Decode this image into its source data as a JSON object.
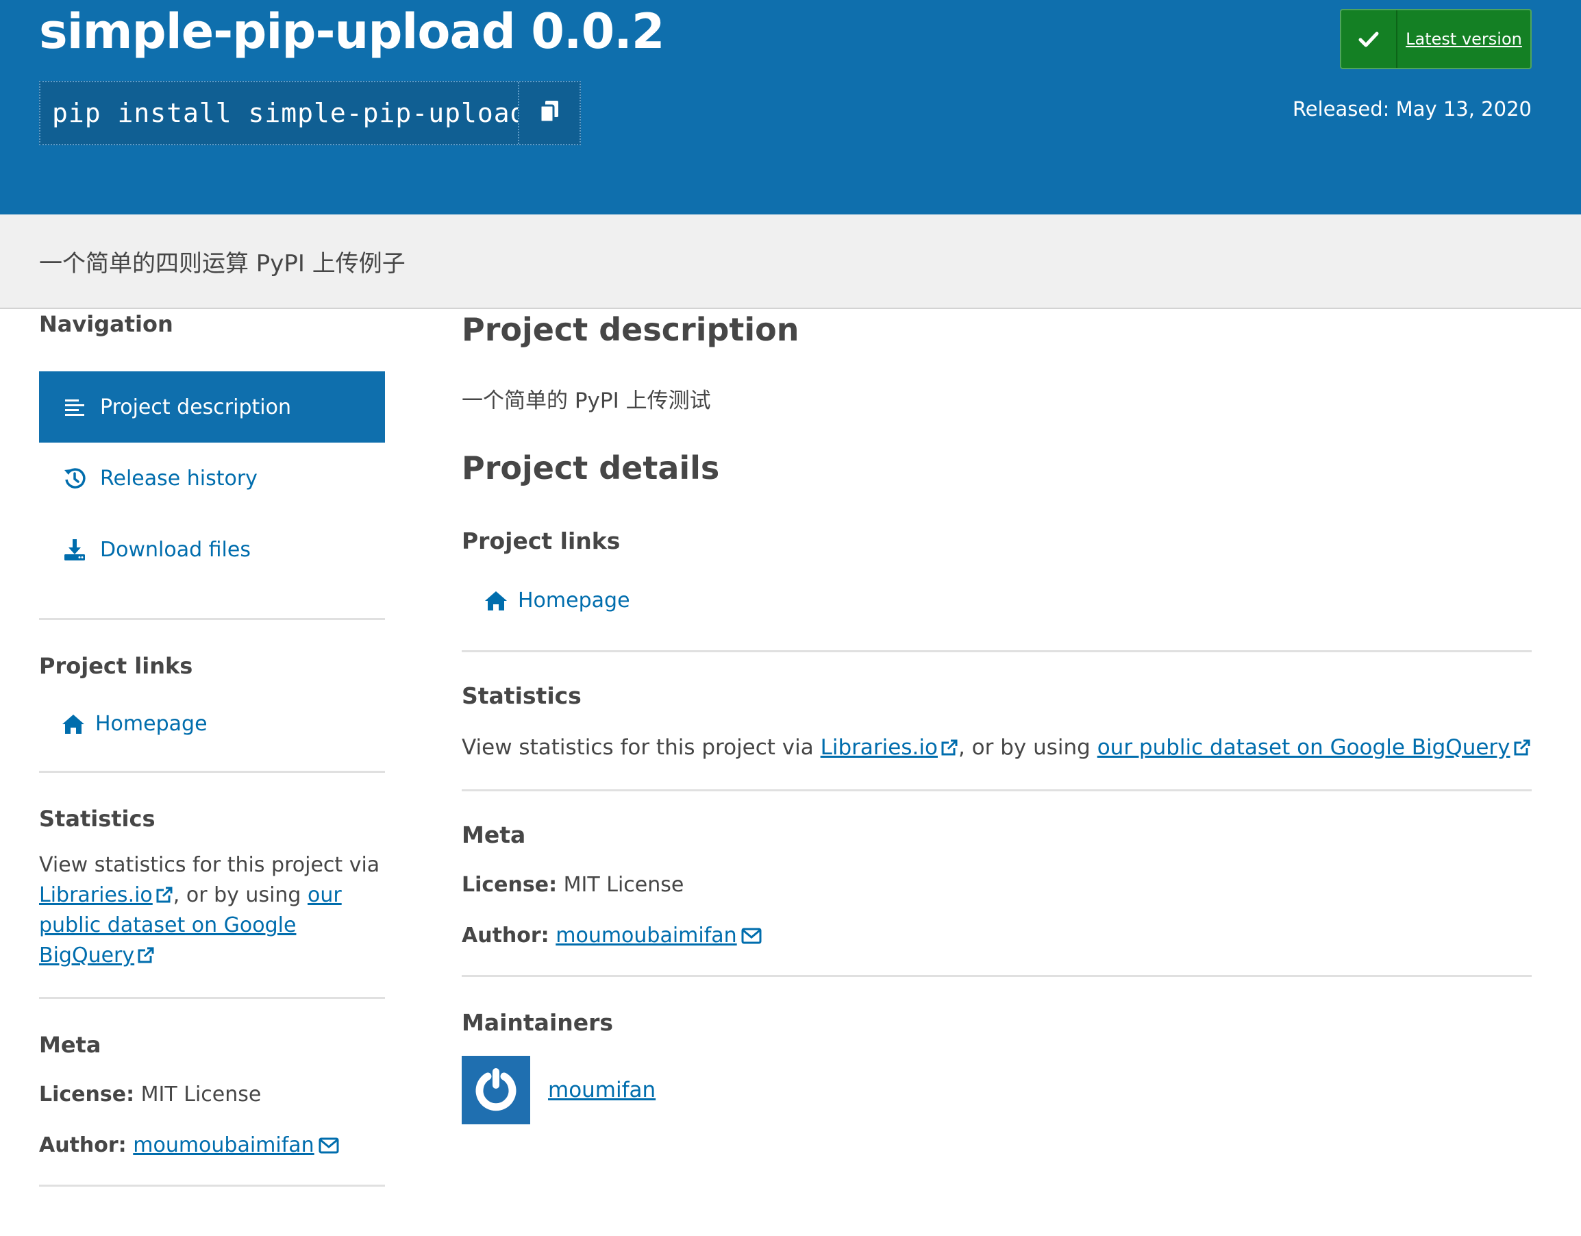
{
  "header": {
    "package_title": "simple-pip-upload 0.0.2",
    "pip_command": "pip install simple-pip-upload",
    "latest_version_label": "Latest version",
    "released_label": "Released:",
    "released_date": "May 13, 2020",
    "colors": {
      "background": "#0f6fad",
      "latest_badge": "#148024"
    }
  },
  "summary": "一个简单的四则运算 PyPI 上传例子",
  "sidebar": {
    "navigation_heading": "Navigation",
    "nav_items": [
      {
        "label": "Project description",
        "icon": "list-icon",
        "active": true
      },
      {
        "label": "Release history",
        "icon": "history-icon",
        "active": false
      },
      {
        "label": "Download files",
        "icon": "download-icon",
        "active": false
      }
    ],
    "project_links_heading": "Project links",
    "homepage_label": "Homepage",
    "statistics_heading": "Statistics",
    "stats_prefix": "View statistics for this project via",
    "stats_libraries": "Libraries.io",
    "stats_middle": ", or by using",
    "stats_bigquery": "our public dataset on Google BigQuery",
    "meta_heading": "Meta",
    "license_label": "License:",
    "license_value": "MIT License",
    "author_label": "Author:",
    "author_value": "moumoubaimifan"
  },
  "main": {
    "project_description_heading": "Project description",
    "description_text": "一个简单的 PyPI 上传测试",
    "project_details_heading": "Project details",
    "project_links_heading": "Project links",
    "homepage_label": "Homepage",
    "statistics_heading": "Statistics",
    "stats_prefix": "View statistics for this project via",
    "stats_libraries": "Libraries.io",
    "stats_middle": ", or by using",
    "stats_bigquery": "our public dataset on Google BigQuery",
    "meta_heading": "Meta",
    "license_label": "License:",
    "license_value": "MIT License",
    "author_label": "Author:",
    "author_value": "moumoubaimifan",
    "maintainers_heading": "Maintainers",
    "maintainer_name": "moumifan"
  }
}
